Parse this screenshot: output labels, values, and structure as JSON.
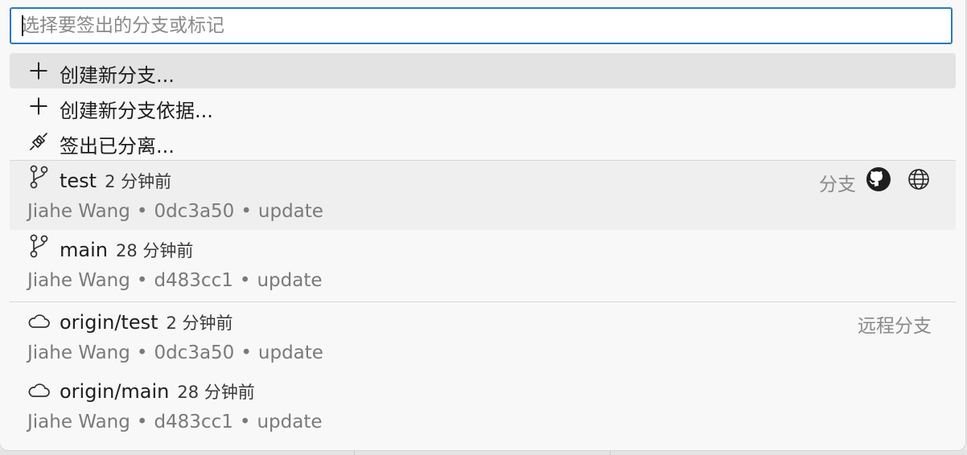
{
  "search": {
    "placeholder": "选择要签出的分支或标记",
    "value": ""
  },
  "actions": [
    {
      "icon": "plus-icon",
      "label": "创建新分支..."
    },
    {
      "icon": "plus-icon",
      "label": "创建新分支依据..."
    },
    {
      "icon": "plug-icon",
      "label": "签出已分离..."
    }
  ],
  "branches": [
    {
      "icon": "git-branch-icon",
      "name": "test",
      "time": "2 分钟前",
      "author": "Jiahe Wang",
      "hash": "0dc3a50",
      "message": "update",
      "kind": "分支",
      "row_actions": [
        "github-icon",
        "globe-icon"
      ]
    },
    {
      "icon": "git-branch-icon",
      "name": "main",
      "time": "28 分钟前",
      "author": "Jiahe Wang",
      "hash": "d483cc1",
      "message": "update"
    }
  ],
  "remote_branches": [
    {
      "icon": "cloud-icon",
      "name": "origin/test",
      "time": "2 分钟前",
      "author": "Jiahe Wang",
      "hash": "0dc3a50",
      "message": "update",
      "kind": "远程分支"
    },
    {
      "icon": "cloud-icon",
      "name": "origin/main",
      "time": "28 分钟前",
      "author": "Jiahe Wang",
      "hash": "d483cc1",
      "message": "update"
    }
  ],
  "separator": "•"
}
